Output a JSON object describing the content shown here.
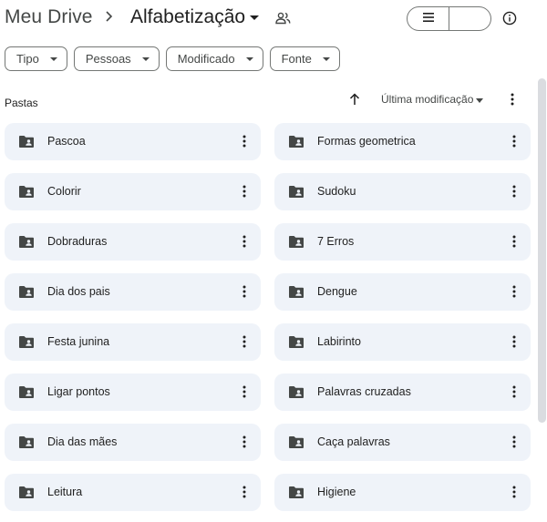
{
  "breadcrumb": {
    "root": "Meu Drive",
    "separator_icon": "chevron-right-icon",
    "current": "Alfabetização",
    "current_menu_icon": "caret-down-icon",
    "shared_icon": "people-icon"
  },
  "toolbar": {
    "view_list_icon": "list-view-icon",
    "view_grid_icon": "grid-view-icon",
    "selected_view": "grid",
    "info_icon": "info-icon",
    "accent_color": "#c2e7ff"
  },
  "filters": [
    {
      "label": "Tipo"
    },
    {
      "label": "Pessoas"
    },
    {
      "label": "Modificado"
    },
    {
      "label": "Fonte"
    }
  ],
  "section": {
    "title": "Pastas",
    "sort_direction_icon": "arrow-up-icon",
    "sort_label": "Última modificação",
    "more_icon": "more-vert-icon"
  },
  "folders": [
    {
      "name": "Pascoa"
    },
    {
      "name": "Formas geometrica"
    },
    {
      "name": "Colorir"
    },
    {
      "name": "Sudoku"
    },
    {
      "name": "Dobraduras"
    },
    {
      "name": "7 Erros"
    },
    {
      "name": "Dia dos pais"
    },
    {
      "name": "Dengue"
    },
    {
      "name": "Festa junina"
    },
    {
      "name": "Labirinto"
    },
    {
      "name": "Ligar pontos"
    },
    {
      "name": "Palavras cruzadas"
    },
    {
      "name": "Dia das mães"
    },
    {
      "name": "Caça palavras"
    },
    {
      "name": "Leitura"
    },
    {
      "name": "Higiene"
    }
  ],
  "folder_icon": "shared-folder-icon",
  "folder_more_icon": "more-vert-icon",
  "folder_card_color": "#eff3f9"
}
